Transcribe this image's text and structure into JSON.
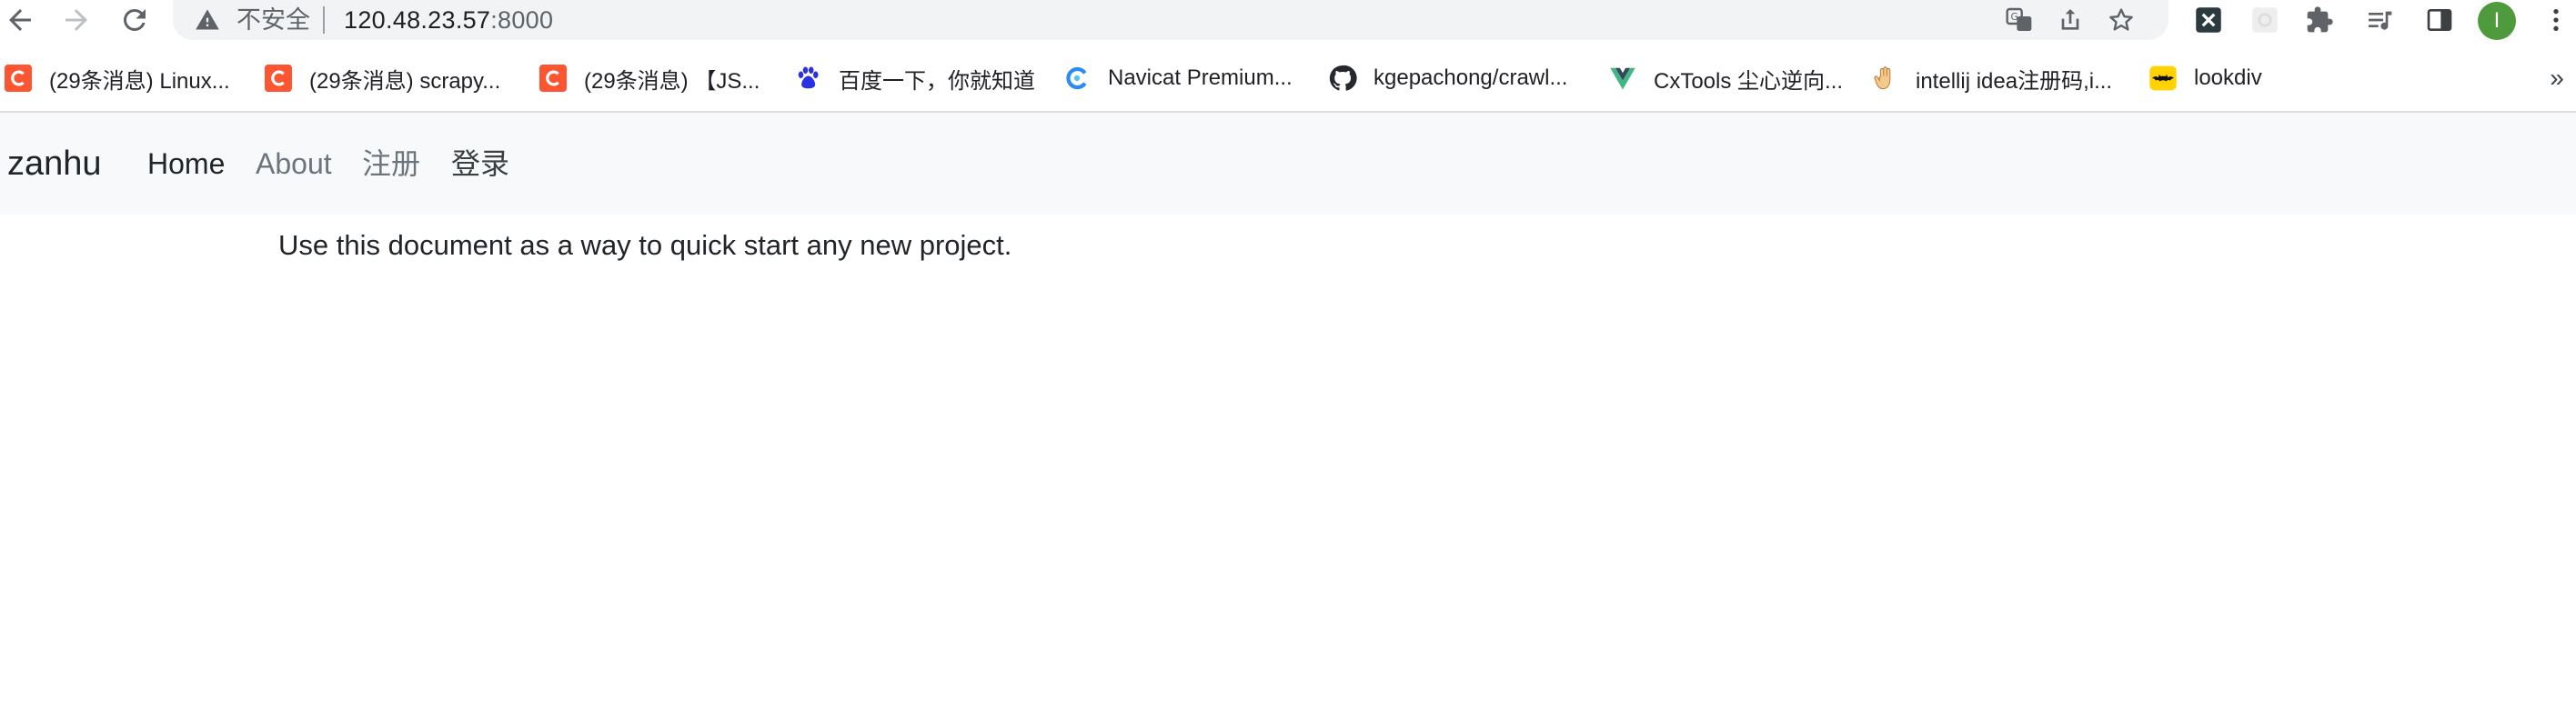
{
  "browser": {
    "security_label": "不安全",
    "url_host": "120.48.23.57",
    "url_port": ":8000",
    "profile_initial": "I",
    "icons": {
      "back": "arrow-left-icon",
      "forward": "arrow-right-icon",
      "reload": "reload-icon",
      "warning": "warning-triangle-icon",
      "translate": "translate-icon",
      "share": "share-icon",
      "bookmark": "star-icon",
      "extension_x": "x-extension-icon",
      "extension_blank": "blank-extension-icon",
      "extensions": "puzzle-icon",
      "reading_list": "reading-list-icon",
      "side_panel": "side-panel-icon",
      "menu": "kebab-menu-icon"
    }
  },
  "bookmarks": {
    "items": [
      {
        "label": "(29条消息) Linux...",
        "icon": "csdn-icon"
      },
      {
        "label": "(29条消息) scrapy...",
        "icon": "csdn-icon"
      },
      {
        "label": "(29条消息) 【JS...",
        "icon": "csdn-icon"
      },
      {
        "label": "百度一下，你就知道",
        "icon": "baidu-paw-icon"
      },
      {
        "label": "Navicat Premium...",
        "icon": "navicat-icon"
      },
      {
        "label": "kgepachong/crawl...",
        "icon": "github-icon"
      },
      {
        "label": "CxTools 尘心逆向...",
        "icon": "vue-icon"
      },
      {
        "label": "intellij idea注册码,i...",
        "icon": "hand-icon"
      },
      {
        "label": "lookdiv",
        "icon": "batman-icon"
      }
    ],
    "more": "»"
  },
  "page": {
    "navbar": {
      "brand": "zanhu",
      "links": [
        "Home",
        "About",
        "注册",
        "登录"
      ]
    },
    "lead": "Use this document as a way to quick start any new project."
  },
  "colors": {
    "csdn": "#fc5531",
    "avatar": "#4f9a3c",
    "navbar_bg": "#f8f9fa",
    "muted_link": "#6c757d",
    "omnibox_bg": "#f1f3f4"
  }
}
